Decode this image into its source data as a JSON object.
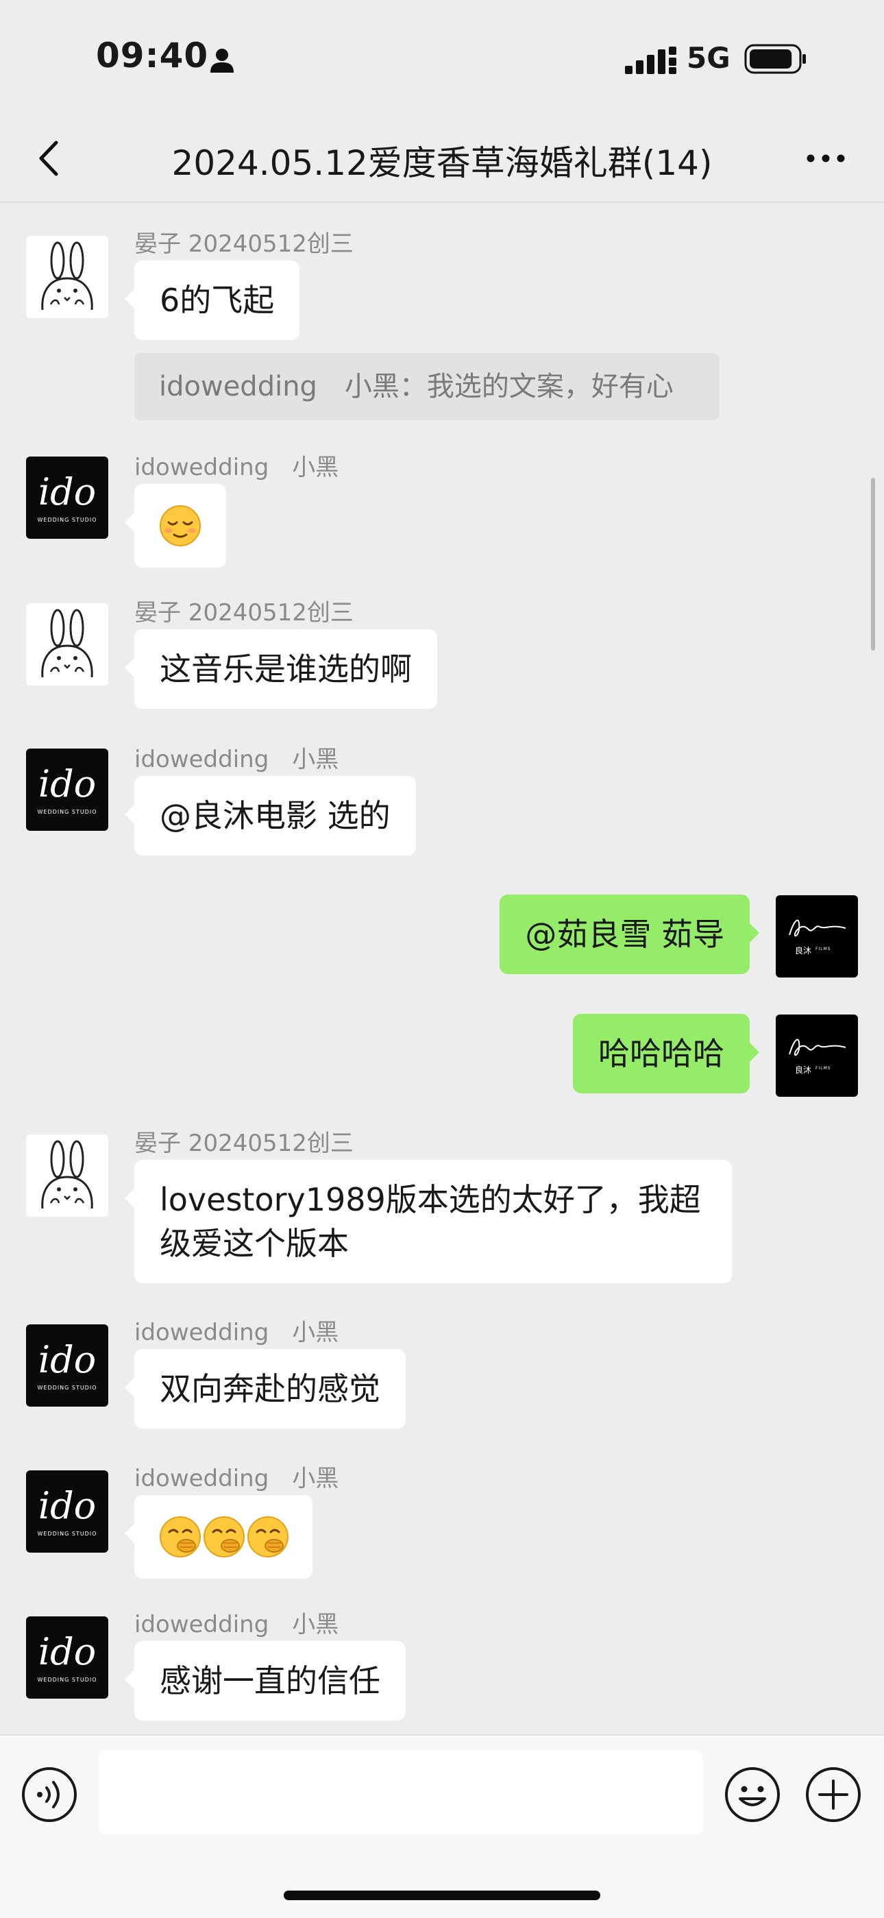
{
  "status_bar": {
    "time": "09:40",
    "network": "5G",
    "battery_level": 0.9
  },
  "header": {
    "title": "2024.05.12爱度香草海婚礼群(14)"
  },
  "messages": {
    "m1": {
      "sender": "晏子 20240512创三",
      "text": "6的飞起"
    },
    "quote": {
      "text": "idowedding　小黑：我选的文案，好有心"
    },
    "m2": {
      "sender": "idowedding　小黑",
      "emoji": "relieved-face",
      "text": ""
    },
    "m3": {
      "sender": "晏子 20240512创三",
      "text": "这音乐是谁选的啊"
    },
    "m4": {
      "sender": "idowedding　小黑",
      "text": "@良沐电影 选的"
    },
    "m5": {
      "text": "@茹良雪 茹导"
    },
    "m6": {
      "text": "哈哈哈哈"
    },
    "m7": {
      "sender": "晏子 20240512创三",
      "text": "lovestory1989版本选的太好了，我超级爱这个版本"
    },
    "m8": {
      "sender": "idowedding　小黑",
      "text": "双向奔赴的感觉"
    },
    "m9": {
      "sender": "idowedding　小黑",
      "emoji": "shy-hand-over-mouth-face",
      "count": 3,
      "text": ""
    },
    "m10": {
      "sender": "idowedding　小黑",
      "text": "感谢一直的信任"
    }
  },
  "avatars": {
    "rabbit": {
      "icon": "rabbit-cartoon-avatar"
    },
    "ido": {
      "label": "ido",
      "sublabel": "WEDDING STUDIO"
    },
    "liangmu": {
      "label": "良沐",
      "sublabel": "FILMS"
    }
  },
  "input": {
    "value": "",
    "placeholder": ""
  },
  "colors": {
    "background": "#ededed",
    "bubble_self": "#95ec69",
    "bubble_other": "#ffffff",
    "sender": "#8a8a8a"
  }
}
